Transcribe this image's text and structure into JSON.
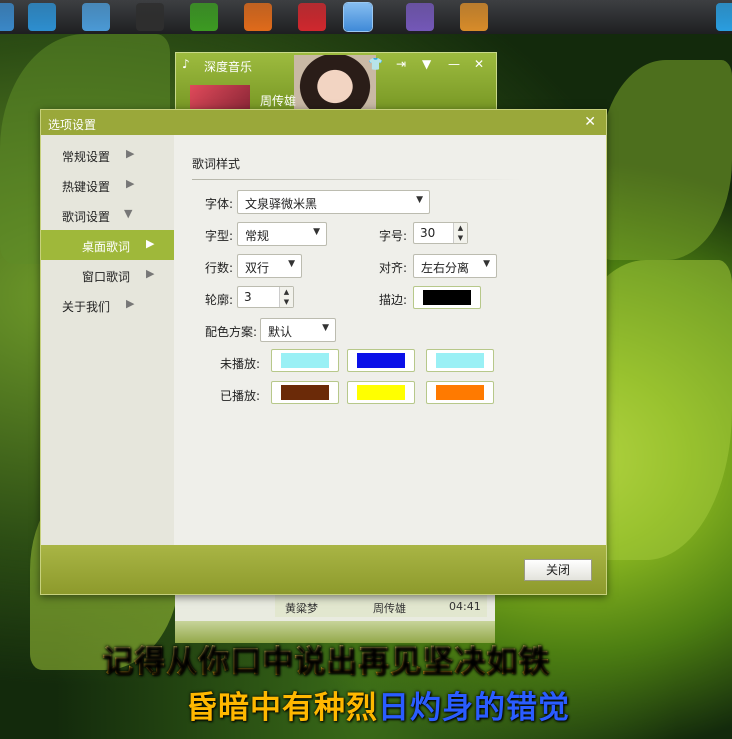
{
  "taskbar": {
    "apps": [
      {
        "icon": "partial-app-icon",
        "color": "#3a88c8"
      },
      {
        "icon": "system-monitor-icon",
        "color": "#2d8fd0"
      },
      {
        "icon": "disk-utility-icon",
        "color": "#4b9ad6"
      },
      {
        "icon": "video-player-icon",
        "color": "#2e2e2e"
      },
      {
        "icon": "android-sdk-icon",
        "color": "#3c9b22"
      },
      {
        "icon": "firefox-icon",
        "color": "#e06b1b"
      },
      {
        "icon": "game-icon",
        "color": "#d0282e"
      },
      {
        "icon": "deepin-music-icon",
        "color": "#3f8ad8",
        "active": true
      },
      {
        "icon": "emacs-icon",
        "color": "#7458b8"
      },
      {
        "icon": "archive-manager-icon",
        "color": "#d88c2a"
      },
      {
        "icon": "partial-blue-icon",
        "color": "#2a9ee0"
      }
    ]
  },
  "music_window": {
    "title": "深度音乐",
    "singer": "周传雄",
    "track_row": {
      "title": "黄粱梦",
      "artist": "周传雄",
      "duration": "04:41"
    }
  },
  "dialog": {
    "title": "选项设置",
    "close_label": "关闭",
    "nav": [
      {
        "label": "常规设置",
        "arrow": "▶",
        "indent": false,
        "selected": false
      },
      {
        "label": "热键设置",
        "arrow": "▶",
        "indent": false,
        "selected": false
      },
      {
        "label": "歌词设置",
        "arrow": "▼",
        "indent": false,
        "selected": false
      },
      {
        "label": "桌面歌词",
        "arrow": "▶",
        "indent": true,
        "selected": true
      },
      {
        "label": "窗口歌词",
        "arrow": "▶",
        "indent": true,
        "selected": false
      },
      {
        "label": "关于我们",
        "arrow": "▶",
        "indent": false,
        "selected": false
      }
    ],
    "section_title": "歌词样式",
    "form": {
      "font_label": "字体:",
      "font_value": "文泉驿微米黑",
      "style_label": "字型:",
      "style_value": "常规",
      "size_label": "字号:",
      "size_value": "30",
      "lines_label": "行数:",
      "lines_value": "双行",
      "align_label": "对齐:",
      "align_value": "左右分离",
      "outline_label": "轮廓:",
      "outline_value": "3",
      "stroke_label": "描边:",
      "stroke_color": "#000000",
      "scheme_label": "配色方案:",
      "scheme_value": "默认",
      "unplayed_label": "未播放:",
      "unplayed_colors": [
        "#9af0f5",
        "#0a10e8",
        "#9af0f5"
      ],
      "played_label": "已播放:",
      "played_colors": [
        "#6b2a08",
        "#ffff00",
        "#ff7a00"
      ]
    }
  },
  "lyrics": {
    "line1": "记得从你口中说出再见坚决如铁",
    "line2_played": "昏暗中有种烈",
    "line2_unplayed": "日灼身的错觉"
  }
}
